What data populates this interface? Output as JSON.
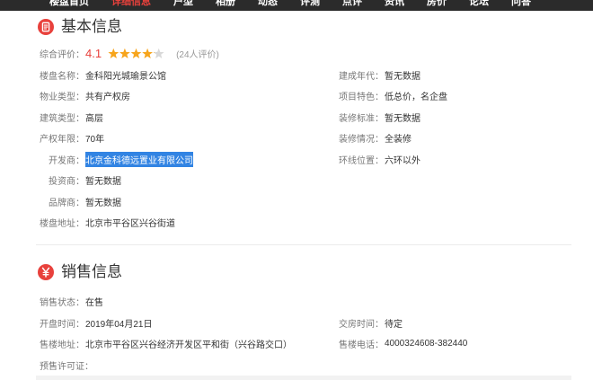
{
  "nav": {
    "items": [
      {
        "label": "楼盘首页",
        "active": false
      },
      {
        "label": "详细信息",
        "active": true
      },
      {
        "label": "户型",
        "active": false
      },
      {
        "label": "相册",
        "active": false
      },
      {
        "label": "动态",
        "active": false
      },
      {
        "label": "评测",
        "active": false
      },
      {
        "label": "点评",
        "active": false
      },
      {
        "label": "资讯",
        "active": false
      },
      {
        "label": "房价",
        "active": false
      },
      {
        "label": "论坛",
        "active": false
      },
      {
        "label": "问答",
        "active": false
      }
    ]
  },
  "basic_info": {
    "title": "基本信息",
    "icon": "document-icon",
    "rating": {
      "label": "综合评价：",
      "score": "4.1",
      "stars": 4.1,
      "stars_max": 5,
      "count": "(24人评价)"
    },
    "rows": [
      {
        "left": {
          "label": "楼盘名称：",
          "value": "金科阳光城瑜景公馆"
        },
        "right": {
          "label": "建成年代：",
          "value": "暂无数据"
        }
      },
      {
        "left": {
          "label": "物业类型：",
          "value": "共有产权房"
        },
        "right": {
          "label": "项目特色：",
          "value": "低总价，名企盘"
        }
      },
      {
        "left": {
          "label": "建筑类型：",
          "value": "高层"
        },
        "right": {
          "label": "装修标准：",
          "value": "暂无数据"
        }
      },
      {
        "left": {
          "label": "产权年限：",
          "value": "70年"
        },
        "right": {
          "label": "装修情况：",
          "value": "全装修"
        }
      },
      {
        "left": {
          "label": "开发商：",
          "value": "北京金科德远置业有限公司",
          "selected": true
        },
        "right": {
          "label": "环线位置：",
          "value": "六环以外"
        }
      },
      {
        "left": {
          "label": "投资商：",
          "value": "暂无数据"
        }
      },
      {
        "left": {
          "label": "品牌商：",
          "value": "暂无数据"
        }
      },
      {
        "left": {
          "label": "楼盘地址：",
          "value": "北京市平谷区兴谷街道"
        }
      }
    ]
  },
  "sales_info": {
    "title": "销售信息",
    "icon": "yuan-icon",
    "rows": [
      {
        "left": {
          "label": "销售状态：",
          "value": "在售"
        }
      },
      {
        "left": {
          "label": "开盘时间：",
          "value": "2019年04月21日"
        },
        "right": {
          "label": "交房时间：",
          "value": "待定"
        }
      },
      {
        "left": {
          "label": "售楼地址：",
          "value": "北京市平谷区兴谷经济开发区平和街（兴谷路交口）"
        },
        "right": {
          "label": "售楼电话：",
          "value": "4000324608-382440"
        }
      },
      {
        "left": {
          "label": "预售许可证："
        }
      }
    ]
  },
  "colors": {
    "accent": "#e8413c",
    "star": "#f7a51c",
    "star_empty": "#d8d8d8",
    "nav_bg": "#2b2b2b",
    "label_text": "#777777",
    "value_text": "#333333",
    "selection_bg": "#3284e3"
  }
}
